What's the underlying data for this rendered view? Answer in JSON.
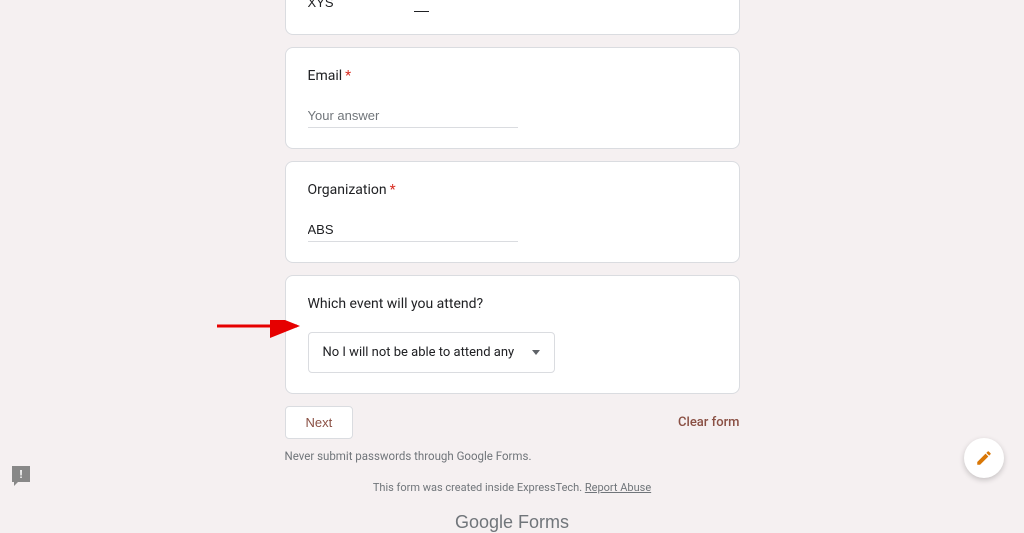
{
  "questions": {
    "name_value": "XYS",
    "email_label": "Email",
    "email_placeholder": "Your answer",
    "org_label": "Organization",
    "org_value": "ABS",
    "event_label": "Which event will you attend?",
    "event_selected": "No I will not be able to attend any"
  },
  "actions": {
    "next": "Next",
    "clear": "Clear form"
  },
  "footer": {
    "warning": "Never submit passwords through Google Forms.",
    "created": "This form was created inside ExpressTech. ",
    "report": "Report Abuse",
    "logo_google": "Google",
    "logo_forms": " Forms"
  }
}
